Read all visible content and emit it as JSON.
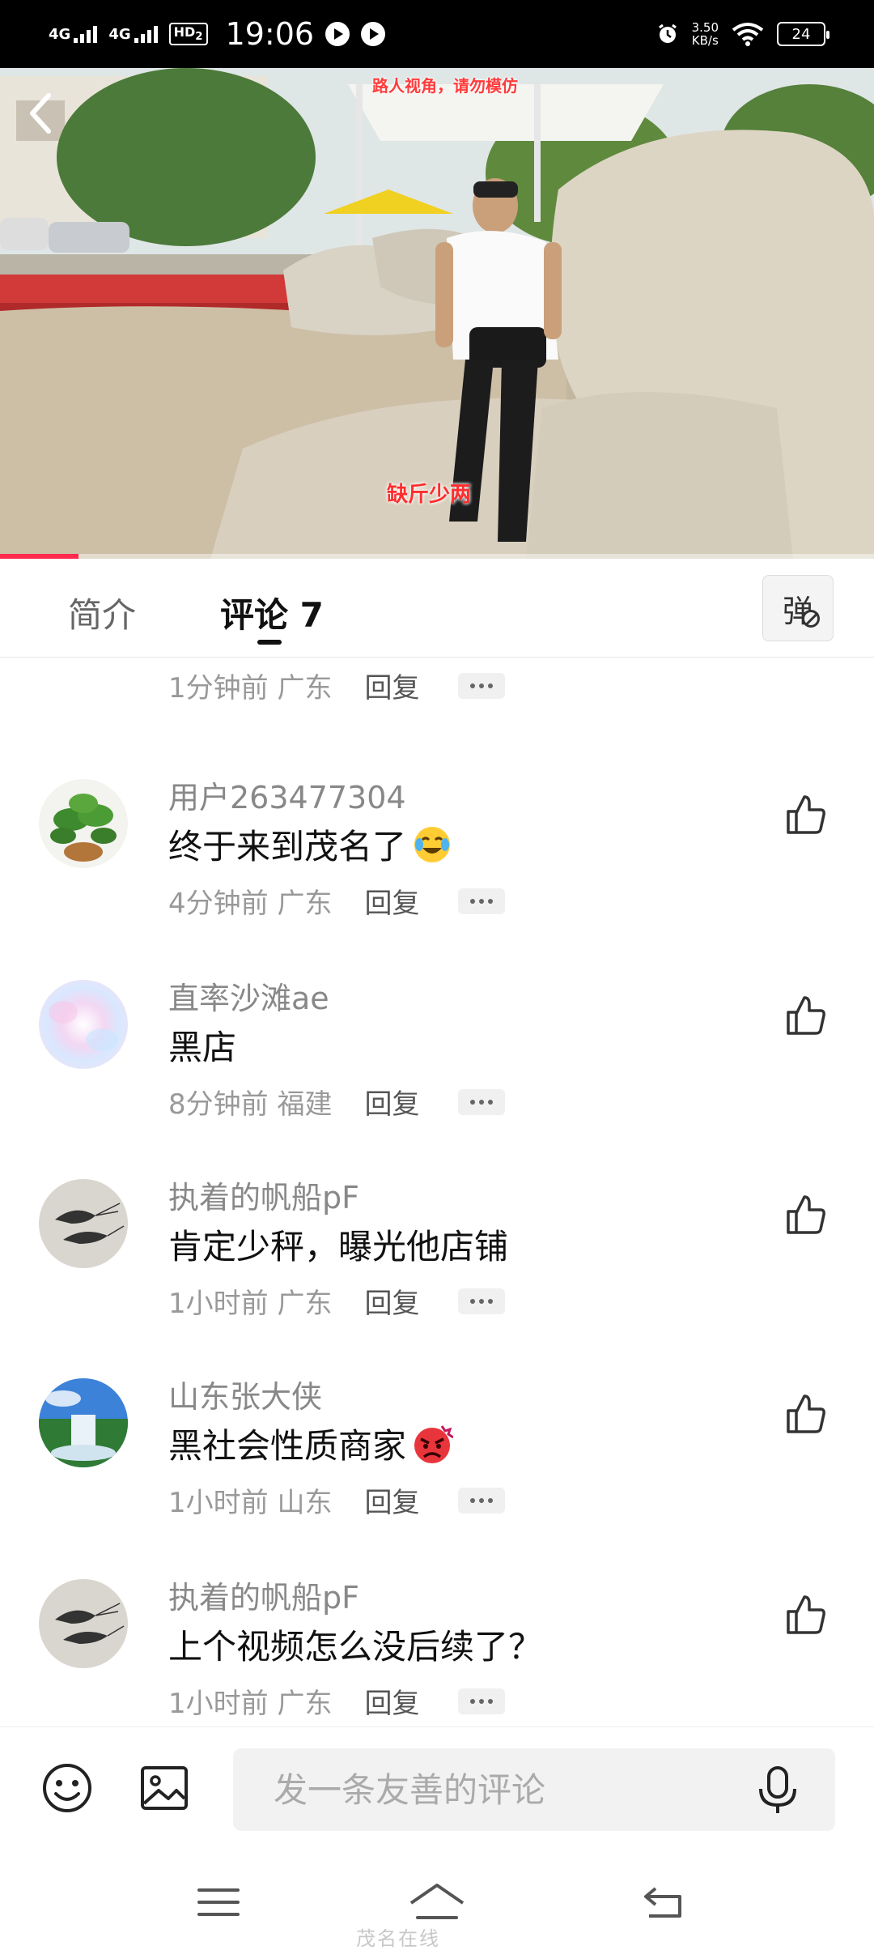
{
  "status_bar": {
    "net1": "4G",
    "net2": "4G",
    "hd_badge": "HD",
    "hd_sub": "2",
    "time": "19:06",
    "speed_value": "3.50",
    "speed_unit": "KB/s",
    "battery": "24"
  },
  "video": {
    "caption_top": "路人视角，请勿模仿",
    "caption_bottom": "缺斤少两",
    "progress_fraction": 0.09
  },
  "tabs": {
    "intro": "简介",
    "comments": "评论 7",
    "danmaku": "弹"
  },
  "top_partial": {
    "time": "1分钟前",
    "location": "广东",
    "reply": "回复"
  },
  "comments": [
    {
      "user": "用户263477304",
      "text": "终于来到茂名了",
      "emoji": "laugh-cry-icon",
      "time": "4分钟前",
      "location": "广东",
      "reply": "回复",
      "avatar": "plant-avatar"
    },
    {
      "user": "直率沙滩ae",
      "text": "黑店",
      "emoji": "",
      "time": "8分钟前",
      "location": "福建",
      "reply": "回复",
      "avatar": "gradient-avatar"
    },
    {
      "user": "执着的帆船pF",
      "text": "肯定少秤，曝光他店铺",
      "emoji": "",
      "time": "1小时前",
      "location": "广东",
      "reply": "回复",
      "avatar": "shrimp-avatar"
    },
    {
      "user": "山东张大侠",
      "text": "黑社会性质商家",
      "emoji": "angry-icon",
      "time": "1小时前",
      "location": "山东",
      "reply": "回复",
      "avatar": "waterfall-avatar"
    },
    {
      "user": "执着的帆船pF",
      "text": "上个视频怎么没后续了？",
      "emoji": "",
      "time": "1小时前",
      "location": "广东",
      "reply": "回复",
      "avatar": "shrimp-avatar"
    }
  ],
  "input_bar": {
    "placeholder": "发一条友善的评论"
  },
  "watermark": "茂名在线"
}
